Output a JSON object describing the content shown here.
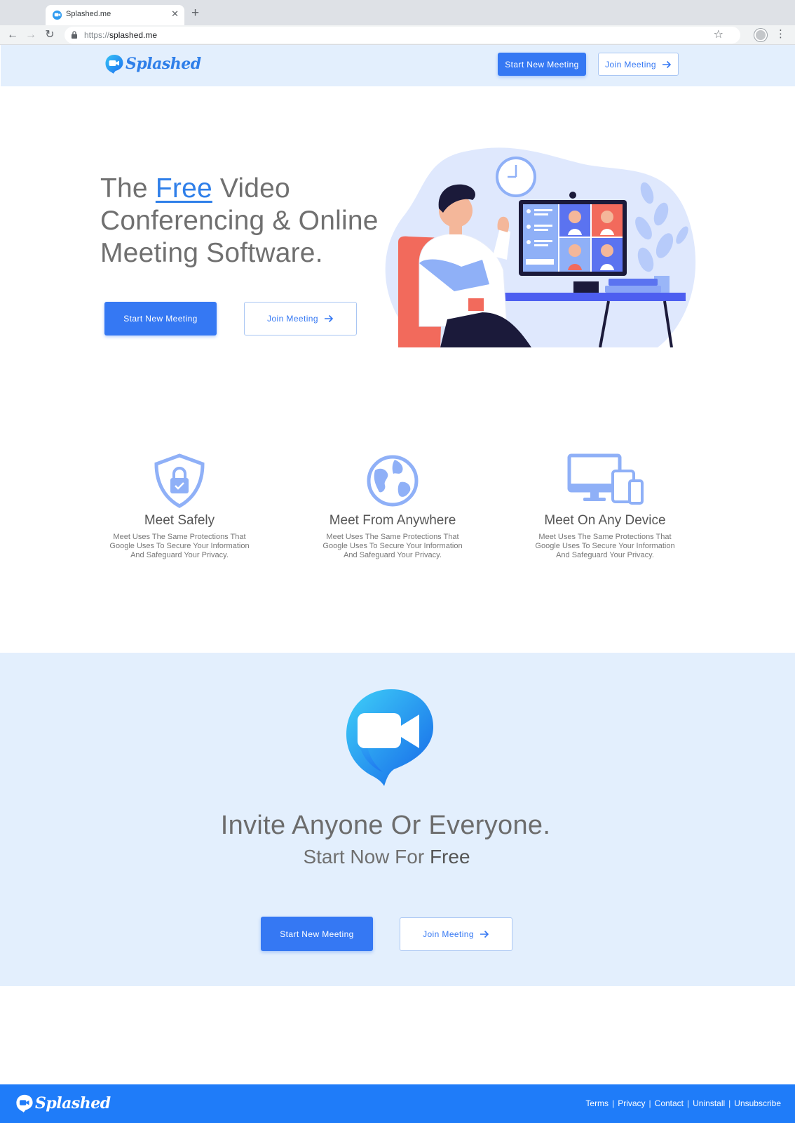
{
  "browser": {
    "tab_title": "Splashed.me",
    "url_scheme": "https://",
    "url_host": "splashed.me"
  },
  "header": {
    "logo_text": "Splashed",
    "start_label": "Start New Meeting",
    "join_label": "Join Meeting"
  },
  "hero": {
    "title_pre": "The",
    "title_highlight": "Free",
    "title_post": "Video Conferencing & Online Meeting Software.",
    "start_label": "Start New Meeting",
    "join_label": "Join Meeting"
  },
  "features": [
    {
      "icon": "shield-lock-icon",
      "title": "Meet Safely",
      "desc": "Meet Uses The Same Protections That Google Uses To Secure Your Information And Safeguard Your Privacy."
    },
    {
      "icon": "globe-icon",
      "title": "Meet From Anywhere",
      "desc": "Meet Uses The Same Protections That Google Uses To Secure Your Information And Safeguard Your Privacy."
    },
    {
      "icon": "devices-icon",
      "title": "Meet On Any Device",
      "desc": "Meet Uses The Same Protections That Google Uses To Secure Your Information And Safeguard Your Privacy."
    }
  ],
  "cta": {
    "title": "Invite Anyone Or Everyone.",
    "sub_pre": "Start Now For",
    "sub_strong": "Free",
    "start_label": "Start New Meeting",
    "join_label": "Join Meeting"
  },
  "footer": {
    "logo_text": "Splashed",
    "links": [
      "Terms",
      "Privacy",
      "Contact",
      "Uninstall",
      "Unsubscribe"
    ],
    "separator": "|"
  },
  "colors": {
    "brand_blue": "#3578f3",
    "light_band": "#e3effd",
    "footer_blue": "#1f7cf9"
  }
}
